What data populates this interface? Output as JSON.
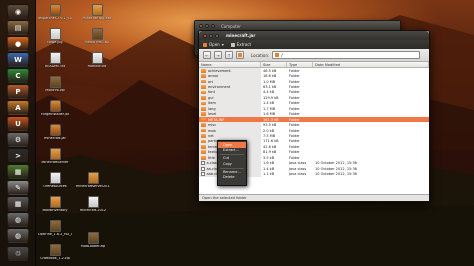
{
  "desktop_icons": [
    {
      "label": "Iexpatcher-2.6.1_64.jar",
      "kind": "jar"
    },
    {
      "label": "minecraftrpg.exe",
      "kind": "box"
    },
    {
      "label": "forge.jpg",
      "kind": "txt"
    },
    {
      "label": "media help.zip",
      "kind": "zip"
    },
    {
      "label": "README.txt",
      "kind": "txt"
    },
    {
      "label": "monitor.txt",
      "kind": "txt"
    },
    {
      "label": "Modinfo.zip",
      "kind": "zip"
    },
    {
      "label": "ForgeInstaller.jar",
      "kind": "jar"
    },
    {
      "label": "minecraft.jar",
      "kind": "jar"
    },
    {
      "label": "MinecraftServer",
      "kind": "box"
    },
    {
      "label": "OreResources",
      "kind": "txt"
    },
    {
      "label": "ModsInventory",
      "kind": "box"
    },
    {
      "label": "OptiFine_1.6.2_HD_U_C6.zip",
      "kind": "zip"
    },
    {
      "label": "Craftbook_1.2.zip",
      "kind": "zip"
    },
    {
      "label": "minecraftserver2012",
      "kind": "box"
    },
    {
      "label": "minecraft-2012",
      "kind": "txt"
    },
    {
      "label": "ModLoader.zip",
      "kind": "zip"
    }
  ],
  "launcher": [
    {
      "name": "dash",
      "color": "#5c4a3a",
      "glyph": "◉"
    },
    {
      "name": "files",
      "color": "#8a6a40",
      "glyph": "▤"
    },
    {
      "name": "firefox",
      "color": "#d8681f",
      "glyph": "●"
    },
    {
      "name": "libreoffice-writer",
      "color": "#3a6ab0",
      "glyph": "W"
    },
    {
      "name": "libreoffice-calc",
      "color": "#2f8a3a",
      "glyph": "C"
    },
    {
      "name": "libreoffice-impress",
      "color": "#b05a2a",
      "glyph": "P"
    },
    {
      "name": "software-center",
      "color": "#c77b2a",
      "glyph": "A"
    },
    {
      "name": "ubuntu-one",
      "color": "#c9521f",
      "glyph": "U"
    },
    {
      "name": "settings",
      "color": "#6a6a6a",
      "glyph": "⚙"
    },
    {
      "name": "terminal",
      "color": "#2b2b2b",
      "glyph": ">"
    },
    {
      "name": "minecraft",
      "color": "#4f7a2f",
      "glyph": "▦"
    },
    {
      "name": "text-editor",
      "color": "#8a8a8a",
      "glyph": "✎"
    },
    {
      "name": "workspaces",
      "color": "#5a5a5a",
      "glyph": "▦"
    },
    {
      "name": "disk",
      "color": "#6a6a6a",
      "glyph": "◍"
    },
    {
      "name": "disk2",
      "color": "#6a6a6a",
      "glyph": "◍"
    },
    {
      "name": "trash",
      "color": "#4a4a4a",
      "glyph": "♲"
    }
  ],
  "back_window": {
    "title": "Computer",
    "crumbs": [
      {
        "label": "Home",
        "active": false
      },
      {
        "label": "minecraft",
        "active": false
      },
      {
        "label": "bin",
        "active": true
      }
    ]
  },
  "window": {
    "title": "minecraft.jar",
    "menus": [
      "Open",
      "Extract"
    ],
    "toolbar": {
      "back": "←",
      "forward": "→",
      "up": "↑",
      "location_label": "Location:",
      "location_value": "/"
    },
    "columns": {
      "name": "Name",
      "size": "Size",
      "type": "Type",
      "date": "Date Modified"
    },
    "rows": [
      {
        "name": "achievement",
        "size": "46.5 kB",
        "type": "Folder",
        "date": "",
        "kind": "folder"
      },
      {
        "name": "armor",
        "size": "18.6 kB",
        "type": "Folder",
        "date": "",
        "kind": "folder"
      },
      {
        "name": "art",
        "size": "1.0 MB",
        "type": "Folder",
        "date": "",
        "kind": "folder"
      },
      {
        "name": "environment",
        "size": "63.1 kB",
        "type": "Folder",
        "date": "",
        "kind": "folder"
      },
      {
        "name": "font",
        "size": "4.4 kB",
        "type": "Folder",
        "date": "",
        "kind": "folder"
      },
      {
        "name": "gui",
        "size": "129.9 kB",
        "type": "Folder",
        "date": "",
        "kind": "folder"
      },
      {
        "name": "item",
        "size": "1.4 kB",
        "type": "Folder",
        "date": "",
        "kind": "folder"
      },
      {
        "name": "lang",
        "size": "1.7 MB",
        "type": "Folder",
        "date": "",
        "kind": "folder"
      },
      {
        "name": "level",
        "size": "1.6 MB",
        "type": "Folder",
        "date": "",
        "kind": "folder"
      },
      {
        "name": "META-INF",
        "size": "161.3 kB",
        "type": "Folder",
        "date": "",
        "kind": "folder"
      },
      {
        "name": "misc",
        "size": "93.5 kB",
        "type": "Folder",
        "date": "",
        "kind": "folder"
      },
      {
        "name": "mob",
        "size": "2.0 kB",
        "type": "Folder",
        "date": "",
        "kind": "folder"
      },
      {
        "name": "net",
        "size": "7.5 MB",
        "type": "Folder",
        "date": "",
        "kind": "folder"
      },
      {
        "name": "particles",
        "size": "171.6 kB",
        "type": "Folder",
        "date": "",
        "kind": "folder"
      },
      {
        "name": "terrain",
        "size": "42.6 kB",
        "type": "Folder",
        "date": "",
        "kind": "folder"
      },
      {
        "name": "textures",
        "size": "81.9 kB",
        "type": "Folder",
        "date": "",
        "kind": "folder"
      },
      {
        "name": "title",
        "size": "3.5 kB",
        "type": "Folder",
        "date": "",
        "kind": "folder"
      },
      {
        "name": "a.class",
        "size": "1.6 kB",
        "type": "Java class",
        "date": "10 October 2012, 15:36",
        "kind": "file"
      },
      {
        "name": "aa.class",
        "size": "1.4 kB",
        "type": "Java class",
        "date": "10 October 2012, 15:36",
        "kind": "file"
      },
      {
        "name": "aab.class",
        "size": "1.1 kB",
        "type": "Java class",
        "date": "10 October 2012, 15:36",
        "kind": "file"
      }
    ],
    "selected_index": 9,
    "status": "Open the selected folder"
  },
  "context_menu": {
    "items": [
      "Open",
      "Extract...",
      "Cut",
      "Copy",
      "Rename...",
      "Delete"
    ],
    "highlight_index": 0
  }
}
